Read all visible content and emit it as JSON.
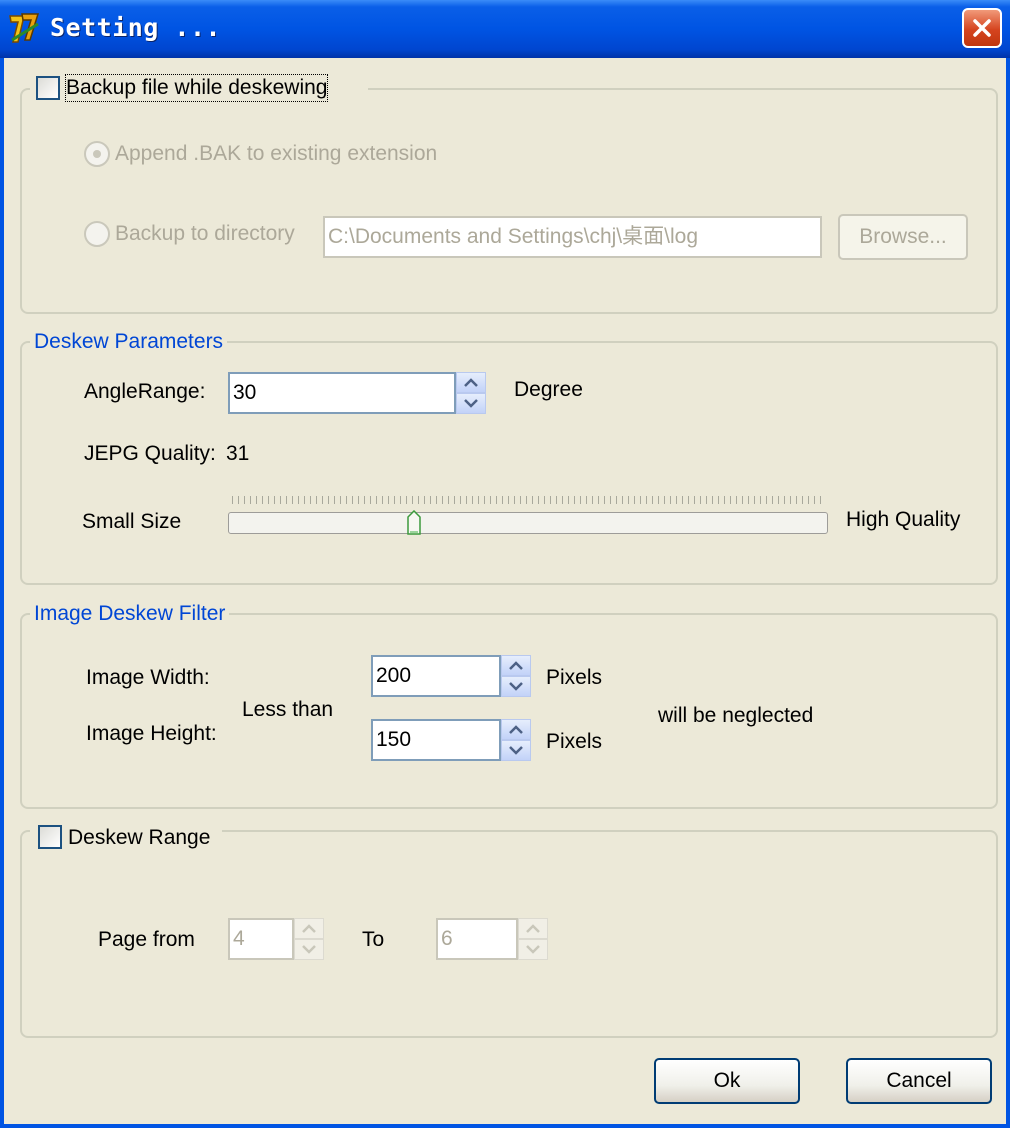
{
  "window": {
    "title": "Setting ..."
  },
  "backup": {
    "checkbox_label": "Backup file while deskewing",
    "radio_append_label": "Append .BAK to existing  extension",
    "radio_dir_label": "Backup to directory",
    "dir_value": "C:\\Documents and Settings\\chj\\桌面\\log",
    "browse_label": "Browse..."
  },
  "deskew_params": {
    "group_title": "Deskew Parameters",
    "angle_label": "AngleRange:",
    "angle_value": "30",
    "angle_unit": "Degree",
    "jpeg_label": "JEPG Quality:",
    "jpeg_value": "31",
    "slider_min_label": "Small Size",
    "slider_max_label": "High Quality",
    "slider_fraction": 0.31
  },
  "filter": {
    "group_title": "Image Deskew Filter",
    "width_label": "Image Width:",
    "height_label": "Image Height:",
    "less_than": "Less than",
    "width_value": "200",
    "height_value": "150",
    "unit_label": "Pixels",
    "neglected": "will be neglected"
  },
  "range": {
    "checkbox_label": "Deskew Range",
    "page_from_label": "Page from",
    "from_value": "4",
    "to_label": "To",
    "to_value": "6"
  },
  "buttons": {
    "ok": "Ok",
    "cancel": "Cancel"
  },
  "colors": {
    "title_bar": "#0054e3",
    "group_title": "#0046d5",
    "dialog_bg": "#ece9d8"
  }
}
